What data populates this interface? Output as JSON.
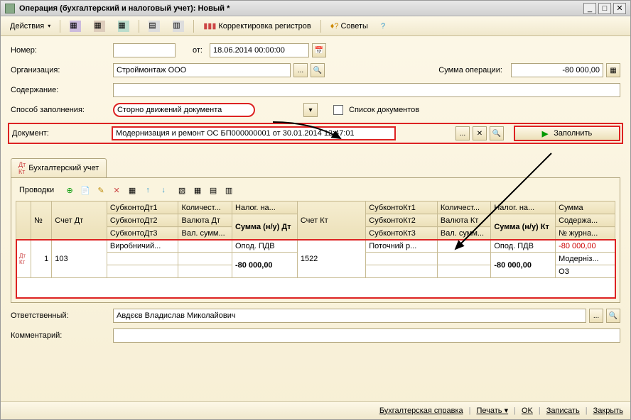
{
  "window": {
    "title": "Операция (бухгалтерский и налоговый учет): Новый *"
  },
  "toolbar": {
    "actions": "Действия",
    "correctReg": "Корректировка регистров",
    "tips": "Советы"
  },
  "form": {
    "number_label": "Номер:",
    "number": "",
    "from_label": "от:",
    "date": "18.06.2014 00:00:00",
    "org_label": "Организация:",
    "org": "Строймонтаж ООО",
    "sum_label": "Сумма операции:",
    "sum": "-80 000,00",
    "content_label": "Содержание:",
    "content": "",
    "fillmode_label": "Способ заполнения:",
    "fillmode": "Сторно движений документа",
    "doclist_label": "Список документов",
    "doc_label": "Документ:",
    "doc": "Модернизация и ремонт ОС БП000000001 от 30.01.2014 12:47:01",
    "fill_btn": "Заполнить"
  },
  "tabs": {
    "tab1": "Бухгалтерский учет"
  },
  "gridtoolbar": {
    "postings": "Проводки"
  },
  "grid": {
    "headers": {
      "n": "№",
      "schetDt": "Счет Дт",
      "sub1": "СубконтоДт1",
      "sub2": "СубконтоДт2",
      "sub3": "СубконтоДт3",
      "qty": "Количест...",
      "currDt": "Валюта Дт",
      "valsum": "Вал. сумм...",
      "tax": "Налог. на...",
      "sumNuDt": "Сумма (н/у) Дт",
      "schetKt": "Счет Кт",
      "subK1": "СубконтоКт1",
      "subK2": "СубконтоКт2",
      "subK3": "СубконтоКт3",
      "qtyK": "Количест...",
      "currKt": "Валюта Кт",
      "valsumK": "Вал. сумм...",
      "taxK": "Налог. на...",
      "sumNuKt": "Сумма (н/у) Кт",
      "summa": "Сумма",
      "content": "Содержа...",
      "journal": "№ журна..."
    },
    "row": {
      "n": "1",
      "schetDt": "103",
      "sub1": "Виробничий...",
      "tax": "Опод. ПДВ",
      "sumNuDt": "-80 000,00",
      "schetKt": "1522",
      "subK1": "Поточний р...",
      "taxK": "Опод. ПДВ",
      "sumNuKt": "-80 000,00",
      "summa": "-80 000,00",
      "content": "Модерніз...",
      "journal": "ОЗ"
    }
  },
  "footer": {
    "resp_label": "Ответственный:",
    "resp": "Авдєєв Владислав Миколайович",
    "comment_label": "Комментарий:",
    "comment": ""
  },
  "bottom": {
    "report": "Бухгалтерская справка",
    "print": "Печать",
    "ok": "OK",
    "save": "Записать",
    "close": "Закрыть"
  }
}
